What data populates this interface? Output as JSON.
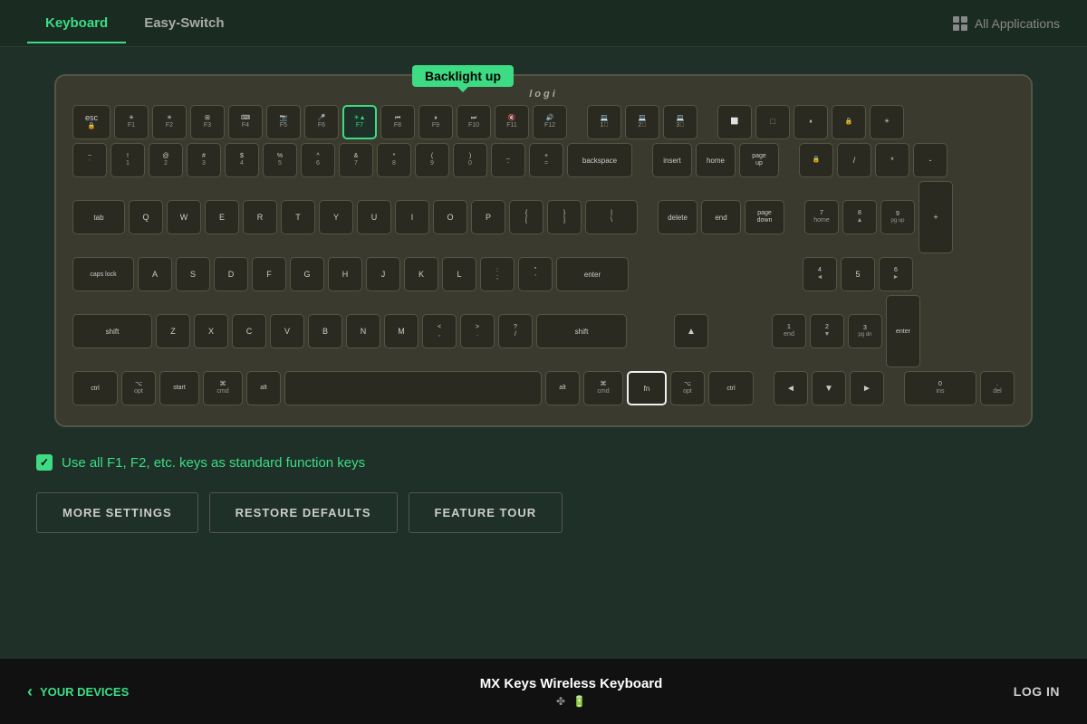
{
  "nav": {
    "tab_keyboard": "Keyboard",
    "tab_easy_switch": "Easy-Switch",
    "all_applications": "All Applications"
  },
  "tooltip": {
    "text": "Backlight up"
  },
  "keyboard": {
    "logo": "logi"
  },
  "checkbox": {
    "label": "Use all F1, F2, etc. keys as standard function keys"
  },
  "buttons": {
    "more_settings": "MORE SETTINGS",
    "restore_defaults": "RESTORE DEFAULTS",
    "feature_tour": "FEATURE TOUR"
  },
  "bottom": {
    "your_devices": "YOUR DEVICES",
    "device_name": "MX Keys Wireless Keyboard",
    "log_in": "LOG IN"
  }
}
